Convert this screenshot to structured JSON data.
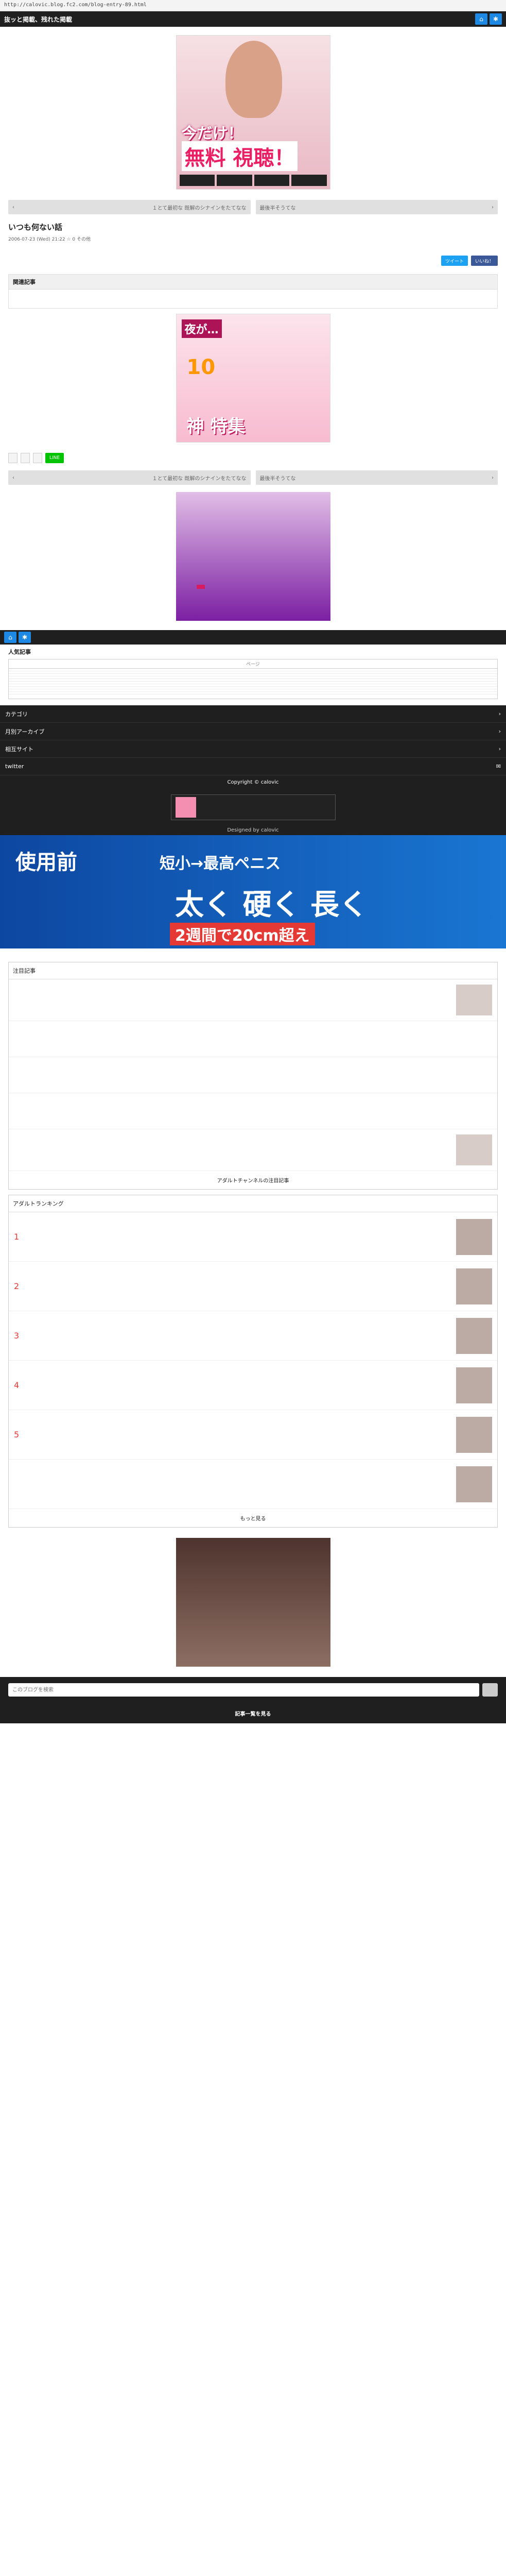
{
  "browser": {
    "url": "http://calovic.blog.fc2.com/blog-entry-89.html"
  },
  "topbar": {
    "title": "抜ッと掲載、残れた掲載"
  },
  "ad_top": {
    "line1": "今だけ！",
    "line2": "無料 視聴！",
    "chips": [
      "",
      "",
      "",
      ""
    ]
  },
  "nav": {
    "prev": "１とて最初な 既解のシナインをたてなな",
    "next": "最後半そうてな"
  },
  "article": {
    "title": "いつも何ない話",
    "meta": "2006-07-23 (Wed) 21:22  ☆ 0  その他",
    "small": "",
    "lines": [
      "",
      "",
      "",
      "",
      "",
      "",
      ""
    ],
    "link": ""
  },
  "share": {
    "tweet": "ツイート",
    "like": "いいね！"
  },
  "related": {
    "head": "関連記事",
    "items": [
      "",
      "",
      "",
      "",
      ""
    ]
  },
  "ad_mid": {
    "t1": "夜が…",
    "t2": "10",
    "t3": "",
    "t4": "神 特集"
  },
  "icons": {
    "b1": "",
    "b2": "",
    "b3": ""
  },
  "ad_game": {
    "t1": "",
    "t2": "",
    "t3": ""
  },
  "popular": {
    "head": "人気記事",
    "pager": "ページ",
    "rows": [
      "",
      "",
      "",
      "",
      "",
      "",
      "",
      "",
      "",
      ""
    ],
    "last": "",
    "more": ""
  },
  "accordion": {
    "items": [
      "カテゴリ",
      "月別アーカイブ",
      "相互サイト",
      "twitter"
    ]
  },
  "copyright": "Copyright © calovic",
  "quiz": {
    "text": ""
  },
  "designed": "Designed by calovic",
  "ad_bottom": {
    "left": "使用前",
    "r1": "短小→最高ペニス",
    "r2": "太く 硬く 長く",
    "r3": "2週間で20cm超え",
    "caption": ""
  },
  "rss": {
    "head": "注目記事",
    "entries": [
      {
        "title": "",
        "sub": ""
      },
      {
        "title": "",
        "sub": ""
      },
      {
        "title": "",
        "sub": ""
      },
      {
        "title": "",
        "sub": ""
      },
      {
        "title": "",
        "sub": ""
      }
    ],
    "foot": "アダルトチャンネルの注目記事"
  },
  "rank": {
    "head": "アダルトランキング",
    "entries": [
      {
        "num": "1",
        "title": ""
      },
      {
        "num": "2",
        "title": ""
      },
      {
        "num": "3",
        "title": ""
      },
      {
        "num": "4",
        "title": ""
      },
      {
        "num": "5",
        "title": ""
      },
      {
        "num": "",
        "title": ""
      }
    ],
    "foot": "もっと見る"
  },
  "ad_last": {
    "text": ""
  },
  "search": {
    "placeholder": "このブログを検索"
  },
  "footer": {
    "text": "記事一覧を見る"
  }
}
